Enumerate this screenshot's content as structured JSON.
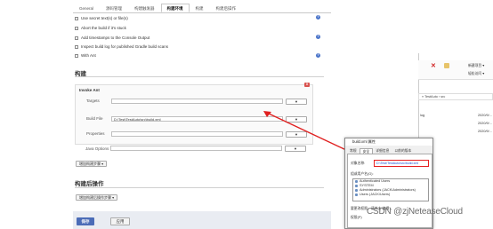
{
  "tabs": [
    "General",
    "源码管理",
    "构建触发器",
    "构建环境",
    "构建",
    "构建后操作"
  ],
  "active_tab_index": 3,
  "build_env_options": [
    "Use secret text(s) or file(s)",
    "Abort the build if it's stuck",
    "Add timestamps to the Console Output",
    "Inspect build log for published Gradle build scans",
    "With Ant"
  ],
  "section_build": "构建",
  "invoke_ant": {
    "title": "Invoke Ant",
    "targets_label": "Targets",
    "targets_value": "",
    "buildfile_label": "Build File",
    "buildfile_value": "D:\\Test\\TestAuto\\src\\build.xml",
    "properties_label": "Properties",
    "java_options_label": "Java Options",
    "delete_label": "X"
  },
  "add_build_step": "增加构建步骤 ▾",
  "section_post_build": "构建后操作",
  "add_post_build_step": "增加构建后操作步骤 ▾",
  "save_button": "保存",
  "apply_button": "应用",
  "explorer": {
    "path": "« TestAuto › src",
    "toolbar": [
      "新建项目 ▾",
      "轻松访问 ▾",
      "新建 文件夹"
    ],
    "files": [
      {
        "name": "log",
        "date": "2020/9/..."
      },
      {
        "name": "",
        "date": "2020/9/..."
      },
      {
        "name": "",
        "date": "2020/9/..."
      }
    ]
  },
  "dialog": {
    "title": "build.xml 属性",
    "tabs": [
      "常规",
      "安全",
      "详细信息",
      "以前的版本"
    ],
    "active_tab_index": 1,
    "object_label": "对象名称:",
    "object_value": "D:\\Test\\TestAuto\\src\\build.xml",
    "group_label": "组或用户名(G):",
    "users": [
      "Authenticated Users",
      "SYSTEM",
      "Administrators (JACK\\Administrators)",
      "Users (JACK\\Users)"
    ],
    "edit_prompt": "要更改权限，请单击\"编辑\"。",
    "perm_label": "权限(P)"
  },
  "watermark": "CSDN @zjNeteaseCloud"
}
